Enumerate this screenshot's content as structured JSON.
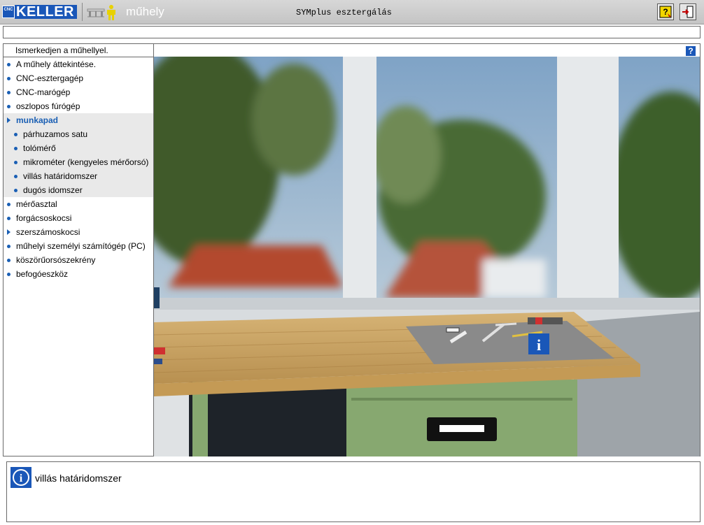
{
  "header": {
    "logo_badge": "CNC",
    "logo_text": "KELLER",
    "mode_label": "műhely",
    "app_title": "SYMplus esztergálás",
    "buttons": [
      "help-topic",
      "exit"
    ]
  },
  "sidebar": {
    "header": "Ismerkedjen a műhellyel.",
    "items": [
      {
        "label": "A műhely áttekintése.",
        "level": 0,
        "marker": "dot"
      },
      {
        "label": "CNC-esztergagép",
        "level": 0,
        "marker": "dot"
      },
      {
        "label": "CNC-marógép",
        "level": 0,
        "marker": "dot"
      },
      {
        "label": "oszlopos fúrógép",
        "level": 0,
        "marker": "dot"
      },
      {
        "label": "munkapad",
        "level": 0,
        "marker": "arrow",
        "active": true
      },
      {
        "label": "párhuzamos satu",
        "level": 1,
        "marker": "dot"
      },
      {
        "label": "tolómérő",
        "level": 1,
        "marker": "dot"
      },
      {
        "label": "mikrométer (kengyeles mérőorsó)",
        "level": 1,
        "marker": "dot"
      },
      {
        "label": "villás határidomszer",
        "level": 1,
        "marker": "dot"
      },
      {
        "label": "dugós idomszer",
        "level": 1,
        "marker": "dot"
      },
      {
        "label": "mérőasztal",
        "level": 0,
        "marker": "dot"
      },
      {
        "label": "forgácsoskocsi",
        "level": 0,
        "marker": "dot"
      },
      {
        "label": "szerszámoskocsi",
        "level": 0,
        "marker": "arrow"
      },
      {
        "label": "műhelyi személyi számítógép (PC)",
        "level": 0,
        "marker": "dot"
      },
      {
        "label": "köszörűorsószekrény",
        "level": 0,
        "marker": "dot"
      },
      {
        "label": "befogóeszköz",
        "level": 0,
        "marker": "dot"
      }
    ]
  },
  "main": {
    "help_label": "?",
    "scene_info_label": "i"
  },
  "info_panel": {
    "icon_label": "i",
    "text": "villás határidomszer"
  },
  "colors": {
    "accent": "#1a5fb4",
    "logo_blue": "#1a57b8",
    "bench_top": "#c9a465",
    "drawer_green": "#7fa86a"
  }
}
